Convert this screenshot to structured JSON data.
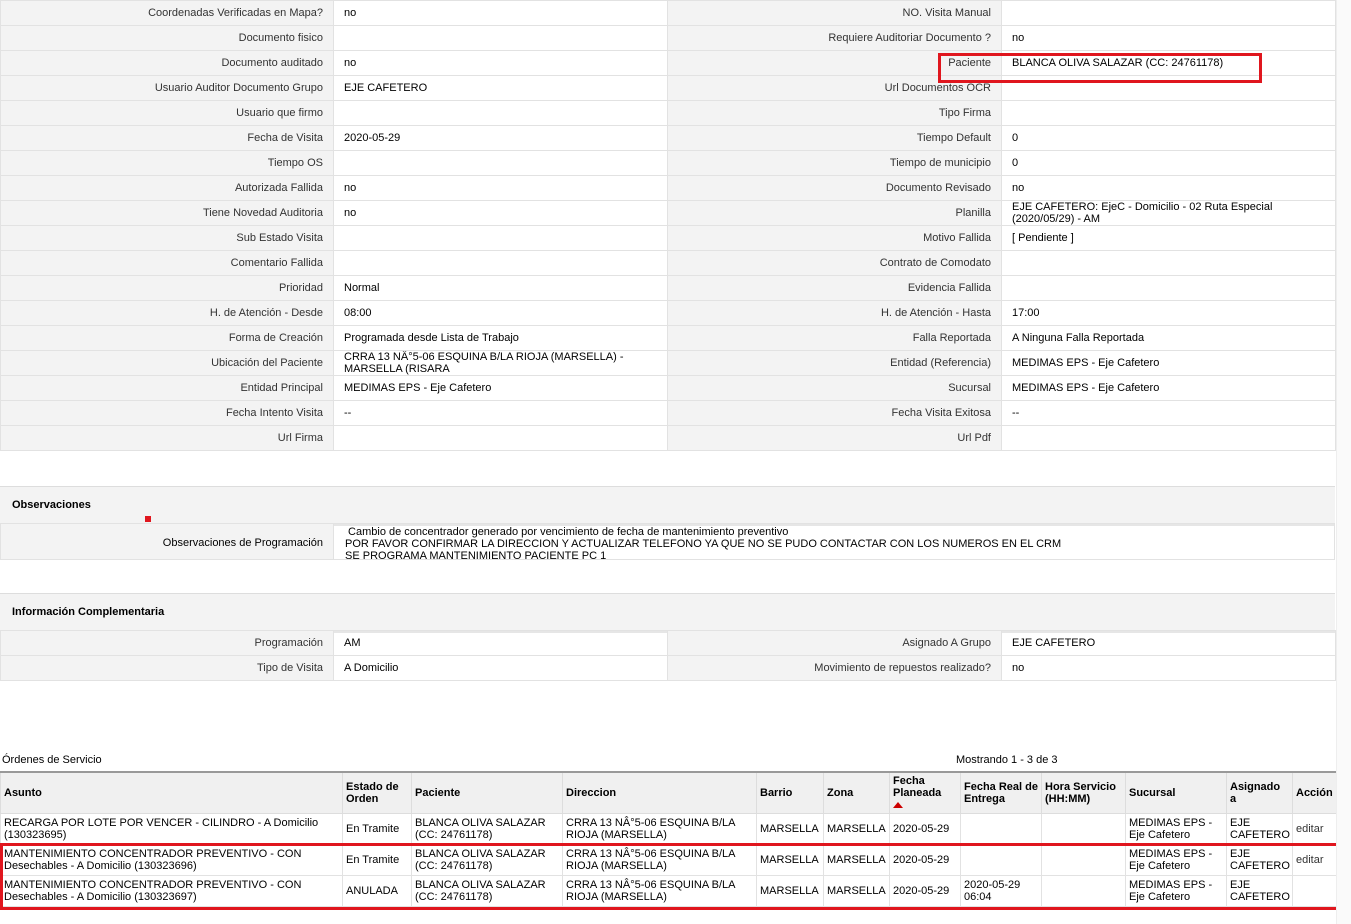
{
  "detail_rows": [
    {
      "l1": "Coordenadas Verificadas en Mapa?",
      "v1": "no",
      "l2": "NO. Visita Manual",
      "v2": ""
    },
    {
      "l1": "Documento fisico",
      "v1": "",
      "l2": "Requiere Auditoriar Documento ?",
      "v2": "no"
    },
    {
      "l1": "Documento auditado",
      "v1": "no",
      "l2": "Paciente",
      "v2": "BLANCA OLIVA SALAZAR (CC: 24761178)"
    },
    {
      "l1": "Usuario Auditor Documento Grupo",
      "v1": "EJE CAFETERO",
      "l2": "Url Documentos OCR",
      "v2": ""
    },
    {
      "l1": "Usuario que firmo",
      "v1": "",
      "l2": "Tipo Firma",
      "v2": ""
    },
    {
      "l1": "Fecha de Visita",
      "v1": "2020-05-29",
      "l2": "Tiempo Default",
      "v2": "0"
    },
    {
      "l1": "Tiempo OS",
      "v1": "",
      "l2": "Tiempo de municipio",
      "v2": "0"
    },
    {
      "l1": "Autorizada Fallida",
      "v1": "no",
      "l2": "Documento Revisado",
      "v2": "no"
    },
    {
      "l1": "Tiene Novedad Auditoria",
      "v1": "no",
      "l2": "Planilla",
      "v2": "EJE CAFETERO: EjeC - Domicilio - 02 Ruta Especial (2020/05/29) - AM"
    },
    {
      "l1": "Sub Estado Visita",
      "v1": "",
      "l2": "Motivo Fallida",
      "v2": "[ Pendiente ]"
    },
    {
      "l1": "Comentario Fallida",
      "v1": "",
      "l2": "Contrato de Comodato",
      "v2": ""
    },
    {
      "l1": "Prioridad",
      "v1": "Normal",
      "l2": "Evidencia Fallida",
      "v2": ""
    },
    {
      "l1": "H. de Atención - Desde",
      "v1": "08:00",
      "l2": "H. de Atención - Hasta",
      "v2": "17:00"
    },
    {
      "l1": "Forma de Creación",
      "v1": "Programada desde Lista de Trabajo",
      "l2": "Falla Reportada",
      "v2": "A Ninguna Falla Reportada"
    },
    {
      "l1": "Ubicación del Paciente",
      "v1": "CRRA 13 NÂ°5-06 ESQUINA B/LA RIOJA (MARSELLA) - MARSELLA (RISARA",
      "l2": "Entidad (Referencia)",
      "v2": "MEDIMAS EPS - Eje Cafetero"
    },
    {
      "l1": "Entidad Principal",
      "v1": "MEDIMAS EPS - Eje Cafetero",
      "l2": "Sucursal",
      "v2": "MEDIMAS EPS - Eje Cafetero"
    },
    {
      "l1": "Fecha Intento Visita",
      "v1": "--",
      "l2": "Fecha Visita Exitosa",
      "v2": "--"
    },
    {
      "l1": "Url Firma",
      "v1": "",
      "l2": "Url Pdf",
      "v2": ""
    }
  ],
  "observaciones": {
    "title": "Observaciones",
    "label": "Observaciones de Programación",
    "text": " Cambio de concentrador generado por vencimiento de fecha de mantenimiento preventivo\nPOR FAVOR CONFIRMAR LA DIRECCION Y ACTUALIZAR TELEFONO YA QUE NO SE PUDO CONTACTAR CON LOS NUMEROS EN EL CRM\nSE PROGRAMA MANTENIMIENTO PACIENTE PC 1"
  },
  "info_comp": {
    "title": "Información Complementaria",
    "rows": [
      {
        "l1": "Programación",
        "v1": "AM",
        "l2": "Asignado A Grupo",
        "v2": "EJE CAFETERO"
      },
      {
        "l1": "Tipo de Visita",
        "v1": "A Domicilio",
        "l2": "Movimiento de repuestos realizado?",
        "v2": "no"
      }
    ]
  },
  "orders": {
    "title": "Órdenes de Servicio",
    "showing": "Mostrando 1 - 3 de 3",
    "columns": [
      "Asunto",
      "Estado de Orden",
      "Paciente",
      "Direccion",
      "Barrio",
      "Zona",
      "Fecha Planeada",
      "Fecha Real de Entrega",
      "Hora Servicio (HH:MM)",
      "Sucursal",
      "Asignado a",
      "Acción"
    ],
    "rows": [
      {
        "asunto": "RECARGA POR LOTE POR VENCER - CILINDRO - A Domicilio (130323695)",
        "estado": "En Tramite",
        "paciente": "BLANCA OLIVA SALAZAR (CC: 24761178)",
        "direccion": "CRRA 13 NÂ°5-06 ESQUINA B/LA RIOJA (MARSELLA)",
        "barrio": "MARSELLA",
        "zona": "MARSELLA",
        "fecha": "2020-05-29",
        "real": "",
        "hora": "",
        "sucursal": "MEDIMAS EPS - Eje Cafetero",
        "asignado": "EJE CAFETERO",
        "accion": "editar"
      },
      {
        "asunto": "MANTENIMIENTO CONCENTRADOR PREVENTIVO - CON Desechables - A Domicilio (130323696)",
        "estado": "En Tramite",
        "paciente": "BLANCA OLIVA SALAZAR (CC: 24761178)",
        "direccion": "CRRA 13 NÂ°5-06 ESQUINA B/LA RIOJA (MARSELLA)",
        "barrio": "MARSELLA",
        "zona": "MARSELLA",
        "fecha": "2020-05-29",
        "real": "",
        "hora": "",
        "sucursal": "MEDIMAS EPS - Eje Cafetero",
        "asignado": "EJE CAFETERO",
        "accion": "editar"
      },
      {
        "asunto": "MANTENIMIENTO CONCENTRADOR PREVENTIVO - CON Desechables - A Domicilio (130323697)",
        "estado": "ANULADA",
        "paciente": "BLANCA OLIVA SALAZAR (CC: 24761178)",
        "direccion": "CRRA 13 NÂ°5-06 ESQUINA B/LA RIOJA (MARSELLA)",
        "barrio": "MARSELLA",
        "zona": "MARSELLA",
        "fecha": "2020-05-29",
        "real": "2020-05-29 06:04",
        "hora": "",
        "sucursal": "MEDIMAS EPS - Eje Cafetero",
        "asignado": "EJE CAFETERO",
        "accion": ""
      }
    ]
  },
  "colors": {
    "highlight": "#e0161e",
    "label_bg": "#f3f3f3"
  }
}
